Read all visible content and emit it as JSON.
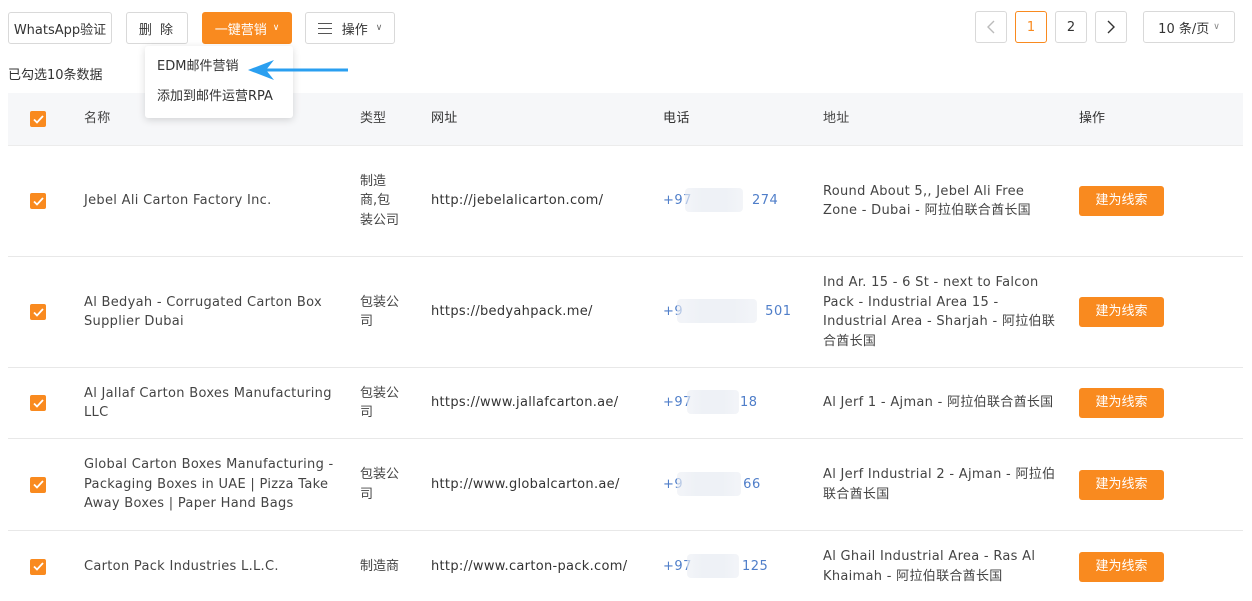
{
  "toolbar": {
    "whatsapp_label": "WhatsApp验证",
    "delete_label": "删 除",
    "marketing_label": "一键营销",
    "operations_label": "操作"
  },
  "marketing_menu": {
    "items": [
      "EDM邮件营销",
      "添加到邮件运营RPA"
    ]
  },
  "pagination": {
    "prev": "<",
    "pages": [
      "1",
      "2"
    ],
    "current": "1",
    "next": ">",
    "page_size": "10 条/页"
  },
  "selection_info": "已勾选10条数据",
  "table": {
    "columns": [
      "名称",
      "类型",
      "网址",
      "电话",
      "地址",
      "操作"
    ],
    "rows": [
      {
        "name": "Jebel Ali Carton Factory Inc.",
        "type": "制造商,包装公司",
        "url": "http://jebelalicarton.com/",
        "phone_prefix": "+97",
        "phone_suffix": "274",
        "address": "Round About 5,, Jebel Ali Free Zone - Dubai - 阿拉伯联合酋长国",
        "action": "建为线索",
        "checked": true
      },
      {
        "name": "Al Bedyah - Corrugated Carton Box Supplier Dubai",
        "type": "包装公司",
        "url": "https://bedyahpack.me/",
        "phone_prefix": "+9",
        "phone_suffix": "501",
        "address": "Ind Ar. 15 - 6 St - next to Falcon Pack - Industrial Area 15 - Industrial Area - Sharjah - 阿拉伯联合酋长国",
        "action": "建为线索",
        "checked": true
      },
      {
        "name": "Al Jallaf Carton Boxes Manufacturing LLC",
        "type": "包装公司",
        "url": "https://www.jallafcarton.ae/",
        "phone_prefix": "+97",
        "phone_suffix": "18",
        "address": "Al Jerf 1 - Ajman - 阿拉伯联合酋长国",
        "action": "建为线索",
        "checked": true
      },
      {
        "name": "Global Carton Boxes Manufacturing - Packaging Boxes in UAE | Pizza Take Away Boxes | Paper Hand Bags",
        "type": "包装公司",
        "url": "http://www.globalcarton.ae/",
        "phone_prefix": "+9",
        "phone_suffix": "66",
        "address": "Al Jerf Industrial 2 - Ajman - 阿拉伯联合酋长国",
        "action": "建为线索",
        "checked": true
      },
      {
        "name": "Carton Pack Industries L.L.C.",
        "type": "制造商",
        "url": "http://www.carton-pack.com/",
        "phone_prefix": "+97",
        "phone_suffix": "125",
        "address": "Al Ghail Industrial Area - Ras Al Khaimah - 阿拉伯联合酋长国",
        "action": "建为线索",
        "checked": true
      }
    ]
  },
  "colors": {
    "accent": "#f98a1f",
    "phone": "#4f7ec9",
    "arrow": "#2a9ff0"
  }
}
